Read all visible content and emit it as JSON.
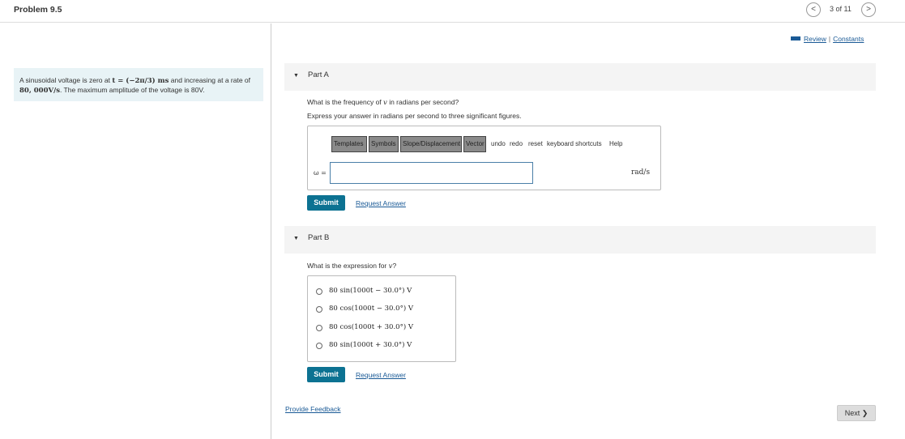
{
  "header": {
    "title": "Problem 9.5",
    "prev_icon": "chevron-left-icon",
    "next_icon": "chevron-right-icon",
    "prev_glyph": "<",
    "next_glyph": ">",
    "page_count": "3 of 11"
  },
  "problem": {
    "text_part1": "A sinusoidal voltage is zero at ",
    "t_expr": "t = (−2π/3) ms",
    "text_part2": " and increasing at a rate of ",
    "rate": "80, 000V/s",
    "text_part3": ". The maximum amplitude of the voltage is 80V."
  },
  "links": {
    "review": "Review",
    "separator": "|",
    "constants": "Constants"
  },
  "part_a": {
    "label": "Part A",
    "toggle_glyph": "▼",
    "question_pre": "What is the frequency of ",
    "question_var": "v",
    "question_post": " in radians per second?",
    "instruction": "Express your answer in radians per second to three significant figures.",
    "toolbar": {
      "templates": "Templates",
      "symbols": "Symbols",
      "slope": "Slope/Displacement",
      "vector": "Vector",
      "undo": "undo",
      "redo": "redo",
      "reset": "reset",
      "shortcuts": "keyboard shortcuts",
      "help": "Help"
    },
    "answer_label": "ω =",
    "answer_value": "",
    "unit": "rad/s",
    "submit": "Submit",
    "request": "Request Answer"
  },
  "part_b": {
    "label": "Part B",
    "toggle_glyph": "▼",
    "question_pre": "What is the expression for ",
    "question_var": "v",
    "question_post": "?",
    "options": [
      "80 sin(1000t − 30.0°) V",
      "80 cos(1000t − 30.0°) V",
      "80 cos(1000t + 30.0°) V",
      "80 sin(1000t + 30.0°) V"
    ],
    "submit": "Submit",
    "request": "Request Answer"
  },
  "footer": {
    "feedback": "Provide Feedback",
    "next": "Next ❯"
  },
  "colors": {
    "accent": "#0c7292",
    "link": "#1a5a96",
    "problem_bg": "#e8f3f6",
    "part_bg": "#f4f4f4"
  }
}
